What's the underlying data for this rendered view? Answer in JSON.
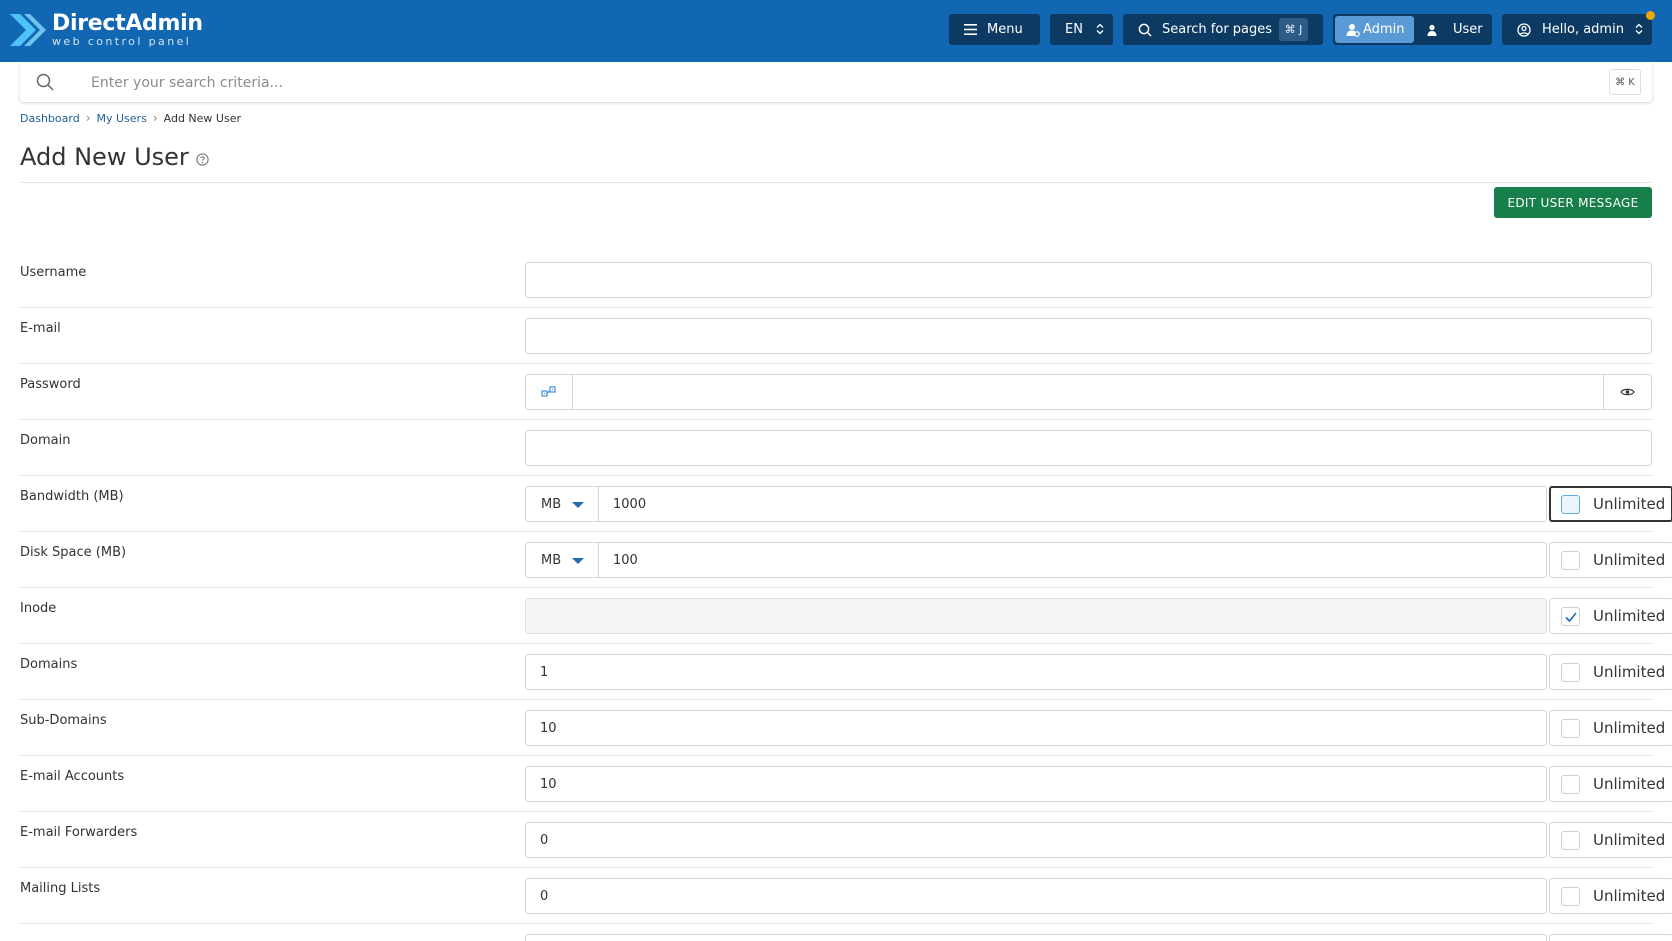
{
  "header": {
    "logo_title": "DirectAdmin",
    "logo_subtitle": "web control panel",
    "menu_label": "Menu",
    "language": "EN",
    "search_pages_label": "Search for pages",
    "search_pages_shortcut": "⌘ J",
    "role_admin": "Admin",
    "role_user": "User",
    "greeting": "Hello, admin",
    "brand_color": "#1167b1",
    "notification_color": "#f0a500"
  },
  "search": {
    "placeholder": "Enter your search criteria...",
    "shortcut": "⌘ K"
  },
  "breadcrumb": {
    "items": [
      "Dashboard",
      "My Users"
    ],
    "current": "Add New User"
  },
  "page": {
    "title": "Add New User",
    "edit_message_button": "EDIT USER MESSAGE"
  },
  "form": {
    "unlimited_label": "Unlimited",
    "fields": [
      {
        "label": "Username",
        "value": ""
      },
      {
        "label": "E-mail",
        "value": ""
      },
      {
        "label": "Password",
        "value": ""
      },
      {
        "label": "Domain",
        "value": ""
      },
      {
        "label": "Bandwidth (MB)",
        "unit": "MB",
        "value": "1000",
        "unlimited": false
      },
      {
        "label": "Disk Space (MB)",
        "unit": "MB",
        "value": "100",
        "unlimited": false
      },
      {
        "label": "Inode",
        "value": "",
        "unlimited": true
      },
      {
        "label": "Domains",
        "value": "1",
        "unlimited": false
      },
      {
        "label": "Sub-Domains",
        "value": "10",
        "unlimited": false
      },
      {
        "label": "E-mail Accounts",
        "value": "10",
        "unlimited": false
      },
      {
        "label": "E-mail Forwarders",
        "value": "0",
        "unlimited": false
      },
      {
        "label": "Mailing Lists",
        "value": "0",
        "unlimited": false
      }
    ]
  }
}
